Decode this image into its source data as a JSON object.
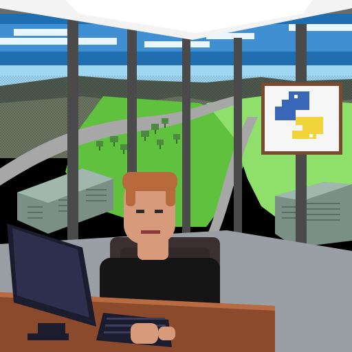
{
  "scene": {
    "description_icons": [
      "python-logo-icon"
    ],
    "colors": {
      "sky_top": "#1f6fb0",
      "sky_mid": "#3f8fd2",
      "sky_bottom": "#9fd6f2",
      "cloud": "#eaf6ff",
      "hill_dark": "#4f5a4e",
      "hill_light": "#6b7561",
      "grass": "#5fc13d",
      "grass_light": "#8fe06b",
      "road": "#a7a7a7",
      "building": "#7a8f86",
      "building_roof": "#9fb7ad",
      "frame": "#4a4a4a",
      "frame_light": "#6b6b6b",
      "ceiling": "#f3f3f3",
      "floor": "#9a9fa5",
      "wall_right": "#8f8f8f",
      "desk": "#8a4a2b",
      "desk_edge": "#b86a40",
      "monitor": "#1b1c2e",
      "monitor_screen": "#2d2f4c",
      "keyboard": "#1b1c2e",
      "skin": "#d79a7a",
      "hair": "#b86a3c",
      "shirt": "#151515",
      "chair": "#3b3030",
      "python_blue": "#3a66b8",
      "python_yellow": "#f0d43a",
      "poster_frame": "#7a4a30",
      "poster_bg": "#f6f6f6"
    }
  }
}
